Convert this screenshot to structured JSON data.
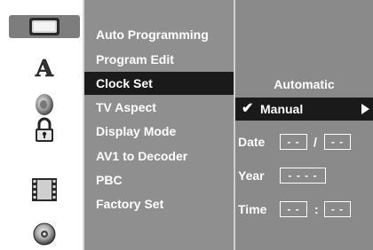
{
  "sidebar": {
    "icons": [
      {
        "name": "display-icon",
        "active": true
      },
      {
        "name": "language-icon",
        "letter": "A",
        "active": false
      },
      {
        "name": "speaker-icon",
        "active": false
      },
      {
        "name": "lock-icon",
        "active": false
      },
      {
        "name": "film-icon",
        "active": false
      },
      {
        "name": "disc-icon",
        "active": false
      }
    ]
  },
  "menu": {
    "items": [
      {
        "label": "Auto Programming"
      },
      {
        "label": "Program Edit"
      },
      {
        "label": "Clock Set",
        "selected": true
      },
      {
        "label": "TV Aspect"
      },
      {
        "label": "Display Mode"
      },
      {
        "label": "AV1 to Decoder"
      },
      {
        "label": "PBC"
      },
      {
        "label": "Factory Set"
      }
    ]
  },
  "clock": {
    "automatic_label": "Automatic",
    "manual_label": "Manual",
    "check_glyph": "✔",
    "date_label": "Date",
    "date_month": "- -",
    "date_sep": "/",
    "date_day": "- -",
    "year_label": "Year",
    "year_value": "- - - -",
    "time_label": "Time",
    "time_hour": "- -",
    "time_sep": ":",
    "time_min": "- -"
  },
  "colors": {
    "menu_bg": "#8f8f8f",
    "selected_bg": "#1a1a1a",
    "active_icon_bg": "#7d7d7d",
    "text": "#ffffff"
  }
}
